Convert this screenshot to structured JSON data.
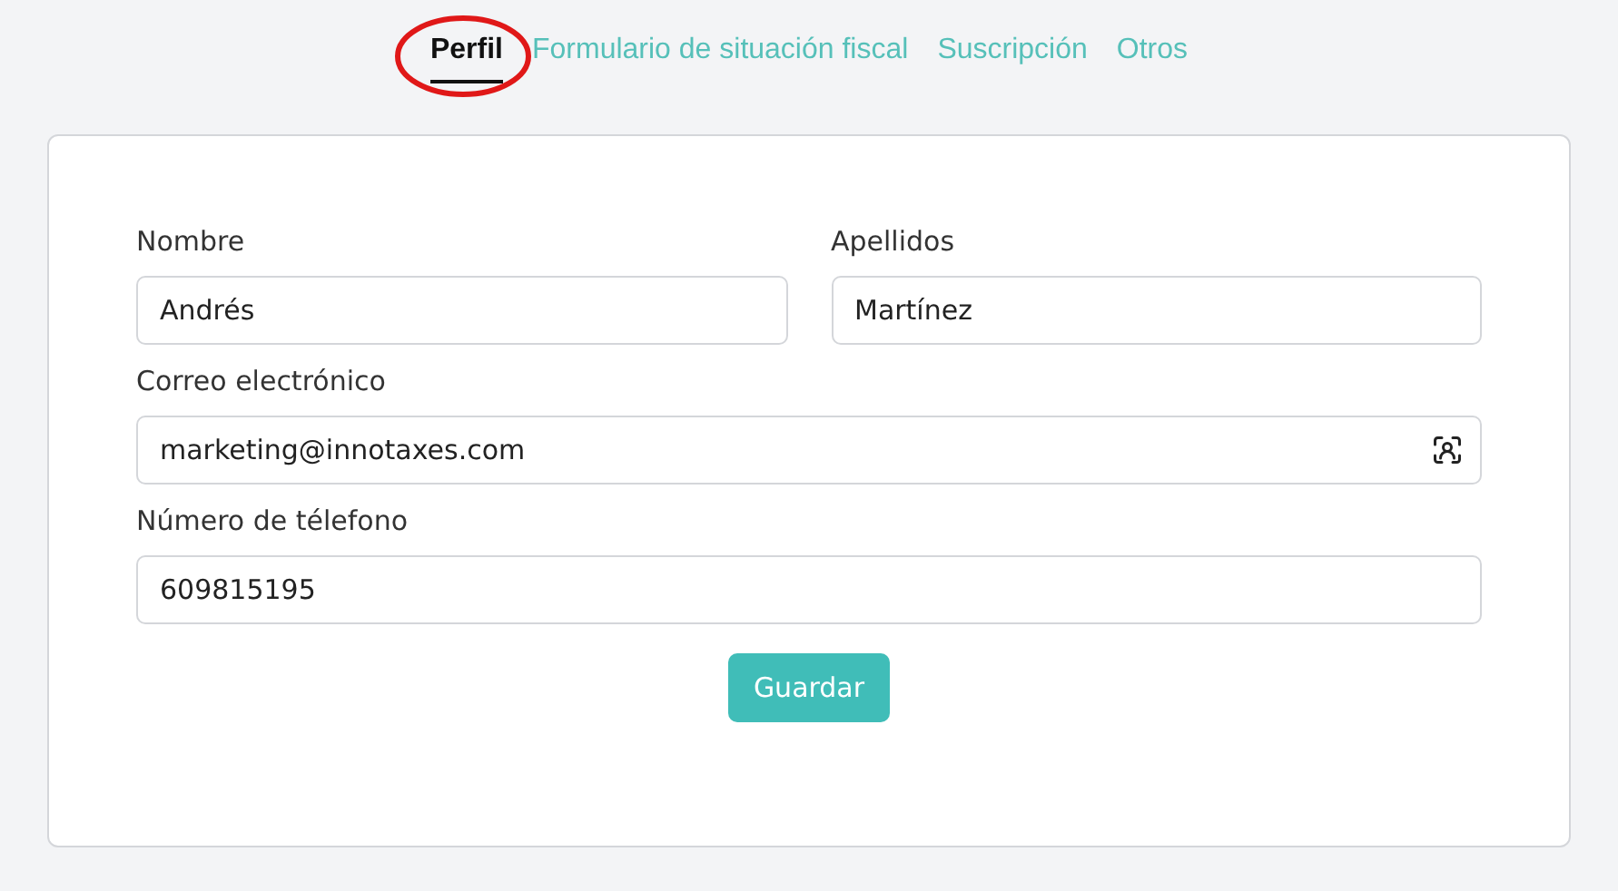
{
  "tabs": [
    {
      "label": "Perfil",
      "selected": true,
      "circled": true
    },
    {
      "label": "Formulario de situación fiscal",
      "selected": false,
      "circled": false
    },
    {
      "label": "Suscripción",
      "selected": false,
      "circled": false
    },
    {
      "label": "Otros",
      "selected": false,
      "circled": false
    }
  ],
  "form": {
    "rows": [
      [
        {
          "label": "Nombre",
          "value": "Andrés",
          "kind": "text"
        },
        {
          "label": "Apellidos",
          "value": "Martínez",
          "kind": "text"
        }
      ],
      [
        {
          "label": "Correo electrónico",
          "value": "marketing@innotaxes.com",
          "kind": "contact"
        }
      ],
      [
        {
          "label": "Número de télefono",
          "value": "609815195",
          "kind": "text"
        }
      ]
    ],
    "submit": "Guardar"
  }
}
